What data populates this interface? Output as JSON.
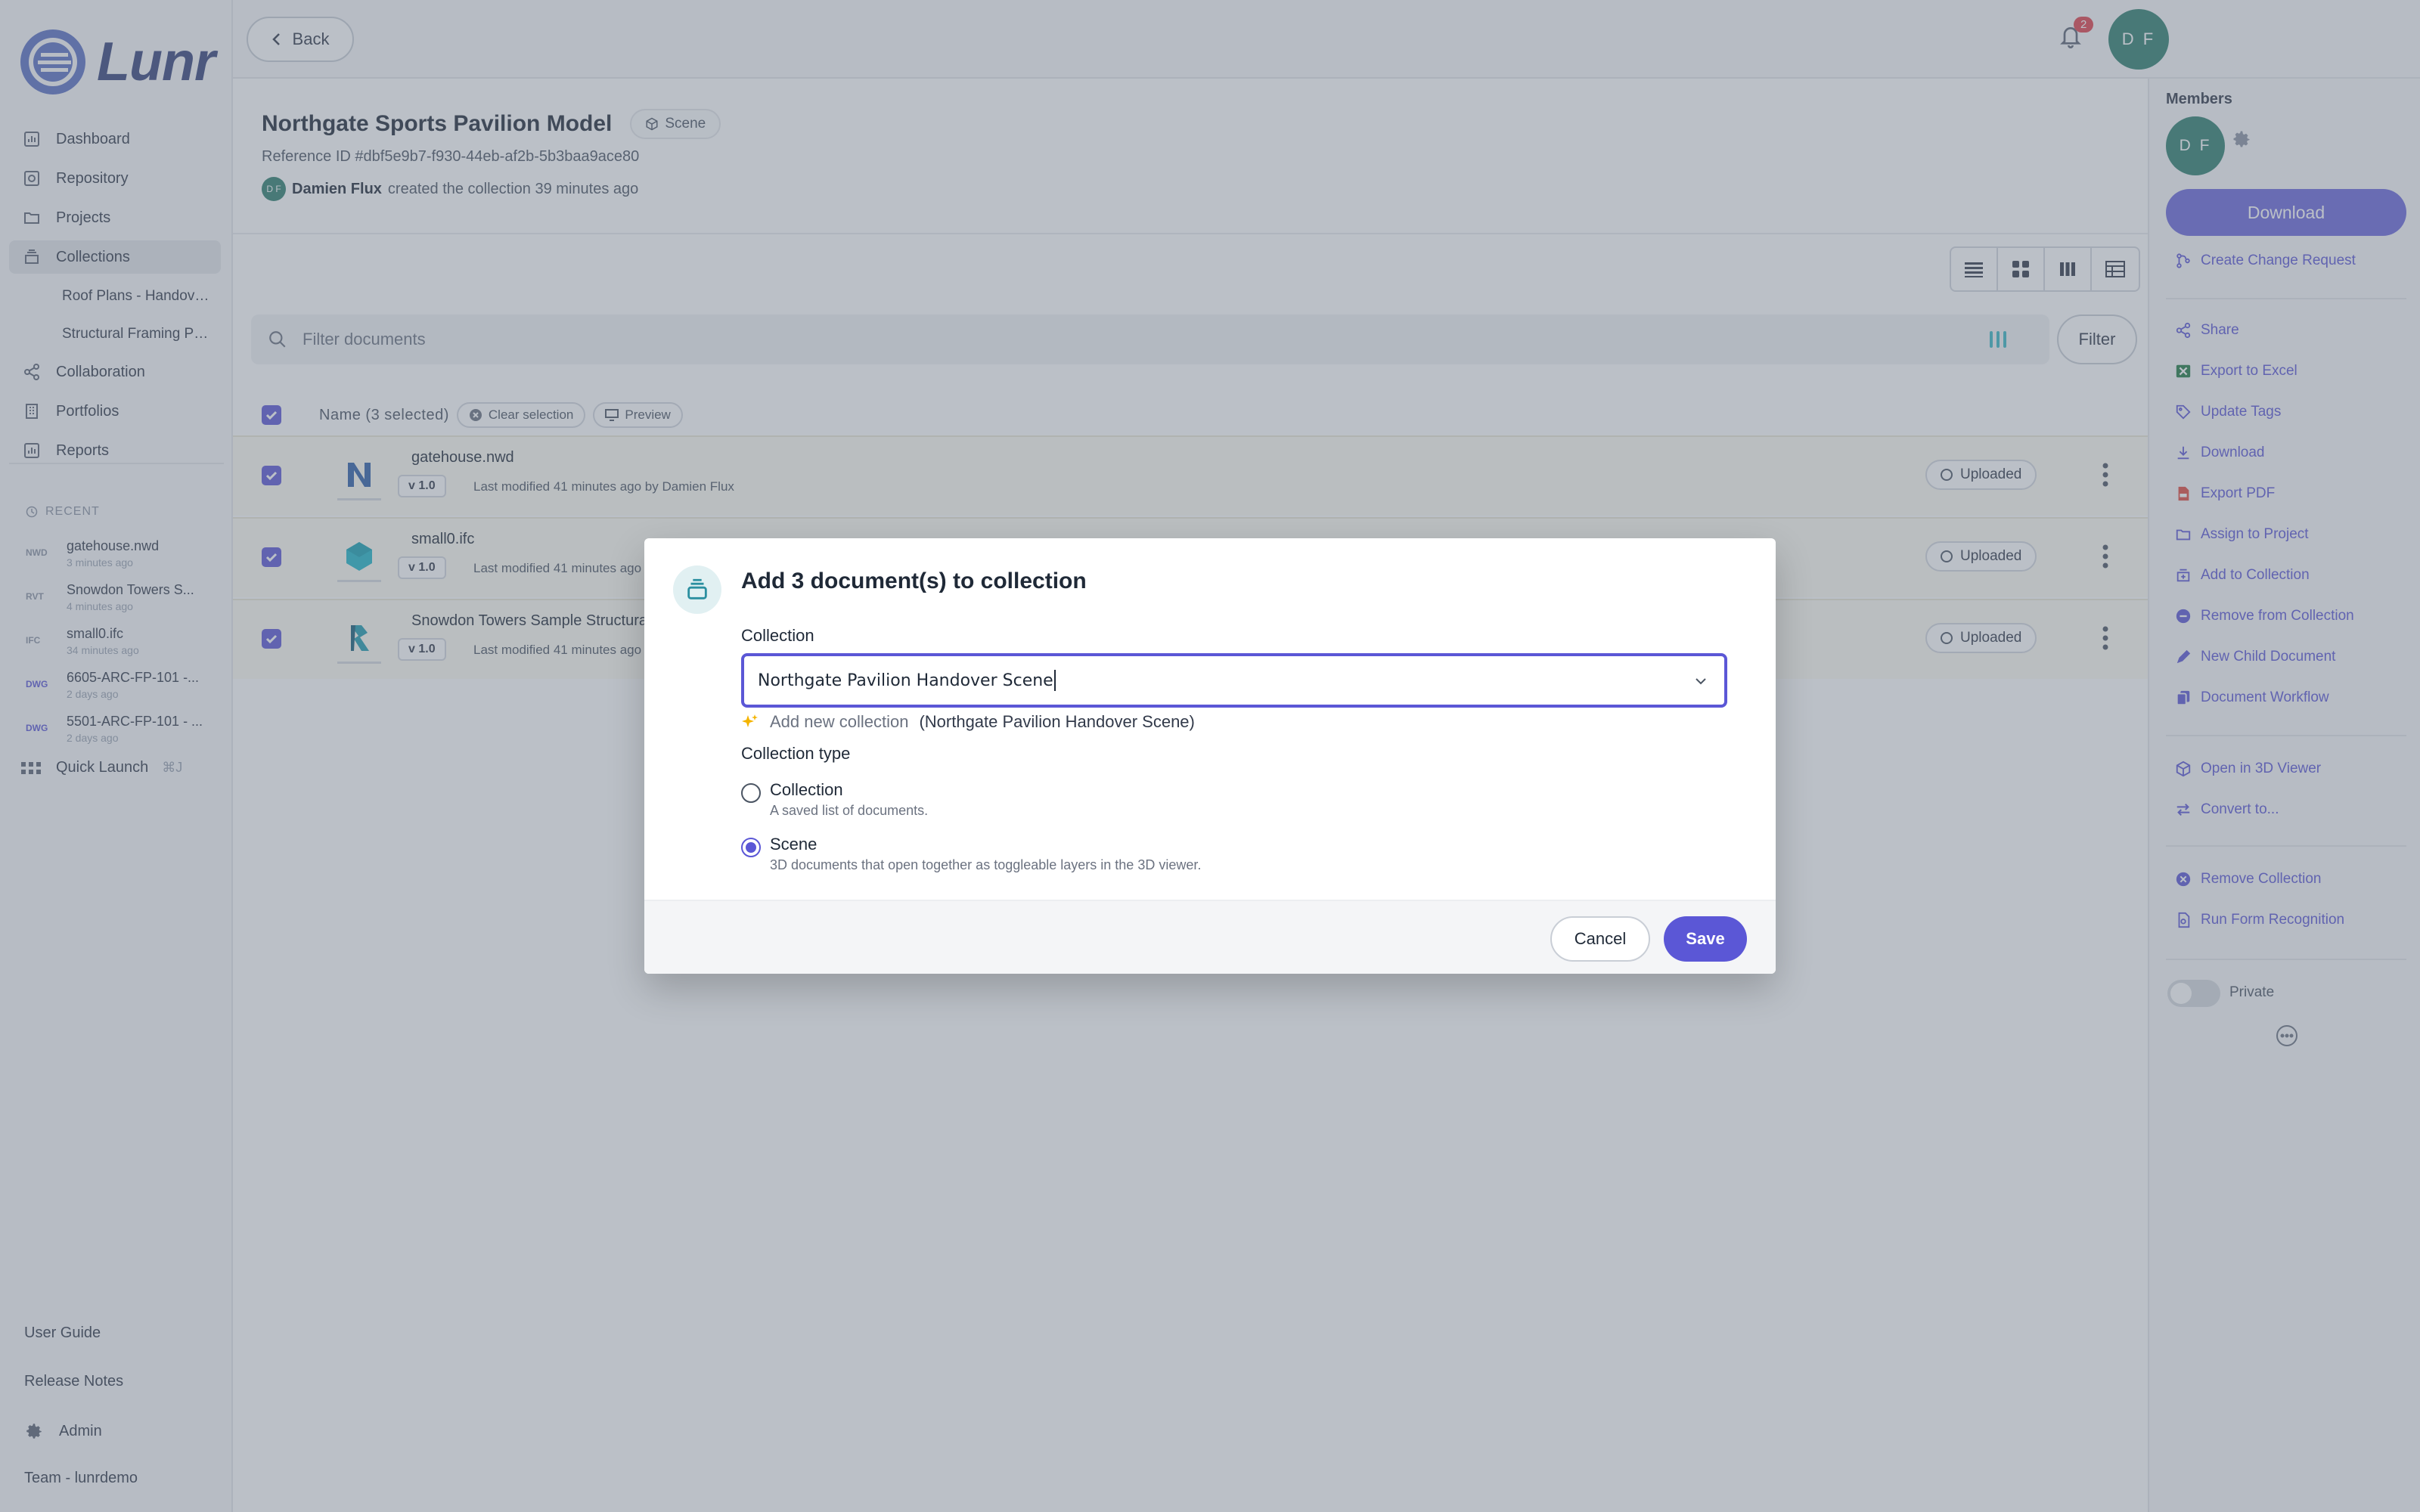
{
  "app": {
    "logo": "Lunr"
  },
  "sidebar": {
    "nav": [
      {
        "label": "Dashboard",
        "icon": "chart-icon"
      },
      {
        "label": "Repository",
        "icon": "repository-icon"
      },
      {
        "label": "Projects",
        "icon": "folder-icon"
      },
      {
        "label": "Collections",
        "icon": "collection-icon"
      }
    ],
    "subitems": [
      "Roof Plans - Handov…",
      "Structural Framing P…"
    ],
    "nav2": [
      {
        "label": "Collaboration",
        "icon": "share-icon"
      },
      {
        "label": "Portfolios",
        "icon": "building-icon"
      },
      {
        "label": "Reports",
        "icon": "chart-icon"
      }
    ],
    "recent_label": "RECENT",
    "recent": [
      {
        "type": "NWD",
        "name": "gatehouse.nwd",
        "time": "3 minutes ago"
      },
      {
        "type": "RVT",
        "name": "Snowdon Towers S...",
        "time": "4 minutes ago"
      },
      {
        "type": "IFC",
        "name": "small0.ifc",
        "time": "34 minutes ago"
      },
      {
        "type": "DWG",
        "name": "6605-ARC-FP-101 -...",
        "time": "2 days ago"
      },
      {
        "type": "DWG",
        "name": "5501-ARC-FP-101 - ...",
        "time": "2 days ago"
      }
    ],
    "quick_launch": "Quick Launch",
    "quick_launch_kbd": "⌘J",
    "footer": [
      "User Guide",
      "Release Notes",
      "Admin",
      "Team - lunrdemo"
    ]
  },
  "topbar": {
    "back": "Back",
    "notifications": "2",
    "avatar": "D F"
  },
  "collection": {
    "title": "Northgate Sports Pavilion Model",
    "badge": "Scene",
    "reference": "Reference ID #dbf5e9b7-f930-44eb-af2b-5b3baa9ace80",
    "creator_initials": "D F",
    "creator_name": "Damien Flux",
    "creator_action": "created the collection 39 minutes ago"
  },
  "filter": {
    "placeholder": "Filter documents",
    "button": "Filter"
  },
  "list": {
    "header": "Name (3 selected)",
    "clear": "Clear selection",
    "preview": "Preview",
    "rows": [
      {
        "name": "gatehouse.nwd",
        "version": "v 1.0",
        "modified": "Last modified 41 minutes ago by Damien Flux",
        "status": "Uploaded"
      },
      {
        "name": "small0.ifc",
        "version": "v 1.0",
        "modified": "Last modified 41 minutes ago by Damien Flux",
        "status": "Uploaded"
      },
      {
        "name": "Snowdon Towers Sample Structural.rvt",
        "version": "v 1.0",
        "modified": "Last modified 41 minutes ago by Damien Flux",
        "status": "Uploaded"
      }
    ]
  },
  "rpanel": {
    "members": "Members",
    "member_initials": "D F",
    "download": "Download",
    "actions1": [
      "Create Change Request"
    ],
    "actions2": [
      "Share",
      "Export to Excel",
      "Update Tags",
      "Download",
      "Export PDF",
      "Assign to Project",
      "Add to Collection",
      "Remove from Collection",
      "New Child Document",
      "Document Workflow"
    ],
    "actions3": [
      "Open in 3D Viewer",
      "Convert to..."
    ],
    "actions4": [
      "Remove Collection",
      "Run Form Recognition"
    ],
    "private": "Private"
  },
  "modal": {
    "title": "Add 3 document(s) to collection",
    "field_label": "Collection",
    "field_value": "Northgate Pavilion Handover Scene",
    "add_new": "Add new collection",
    "add_new_name": "(Northgate Pavilion Handover Scene)",
    "type_label": "Collection type",
    "options": [
      {
        "title": "Collection",
        "desc": "A saved list of documents.",
        "selected": false
      },
      {
        "title": "Scene",
        "desc": "3D documents that open together as toggleable layers in the 3D viewer.",
        "selected": true
      }
    ],
    "cancel": "Cancel",
    "save": "Save"
  },
  "colors": {
    "accent": "#5b57d6",
    "avatar": "#2e7f6e",
    "badge": "#e0414b"
  }
}
